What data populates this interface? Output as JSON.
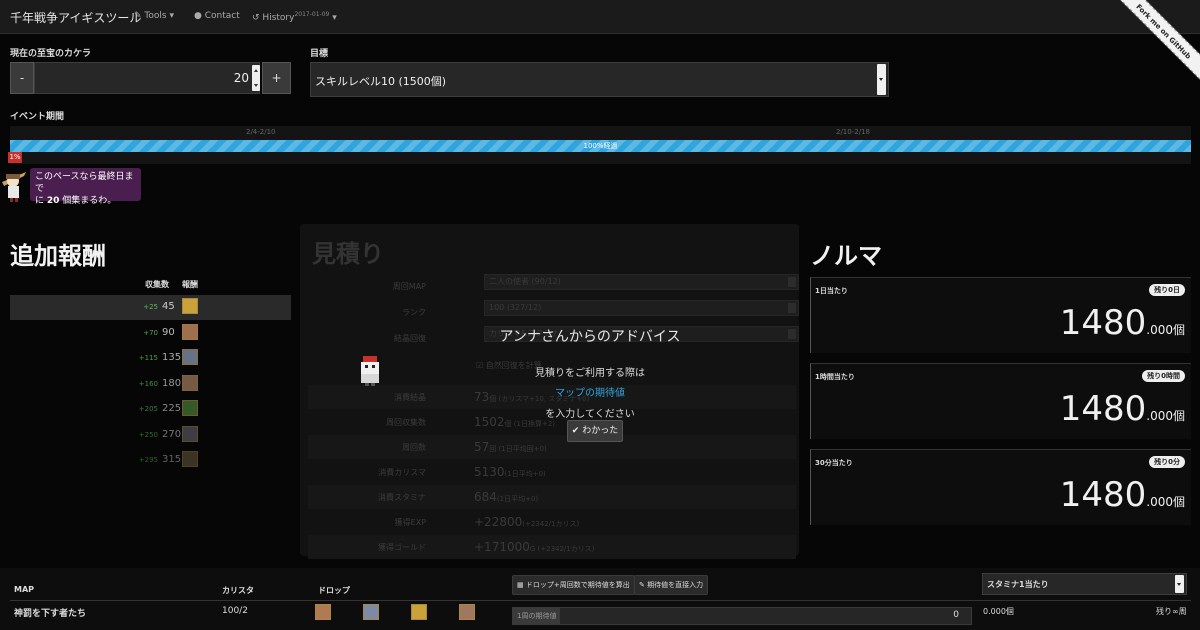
{
  "nav": {
    "brand": "千年戦争アイギスツール",
    "tools": "Tools",
    "contact": "Contact",
    "history": "History",
    "history_date": "2017-01-09",
    "fork_ribbon": "Fork me on GitHub"
  },
  "form": {
    "kakera_label": "現在の至宝のカケラ",
    "kakera_value": "20",
    "minus": "-",
    "plus": "+",
    "target_label": "目標",
    "target_value": "スキルレベル10 (1500個)"
  },
  "event": {
    "label": "イベント期間",
    "phase1": "2/4-2/10",
    "phase2": "2/10-2/18",
    "progress_text": "100%経過",
    "progress_fraction": 1.0,
    "percent_badge": "1%",
    "bubble_line1": "このペースなら最終日まで",
    "bubble_pre": "に ",
    "bubble_count": "20",
    "bubble_post": " 個集まるわ。"
  },
  "rewards": {
    "title": "追加報酬",
    "col_count": "収集数",
    "col_reward": "報酬",
    "rows": [
      {
        "delta": "+25",
        "count": "45",
        "color": "#c9a23a"
      },
      {
        "delta": "+70",
        "count": "90",
        "color": "#b07a55"
      },
      {
        "delta": "+115",
        "count": "135",
        "color": "#7d8aa6"
      },
      {
        "delta": "+160",
        "count": "180",
        "color": "#a07860"
      },
      {
        "delta": "+205",
        "count": "225",
        "color": "#4f8a3e"
      },
      {
        "delta": "+250",
        "count": "270",
        "color": "#6a6a7a"
      },
      {
        "delta": "+295",
        "count": "315",
        "color": "#7a6a4a"
      }
    ]
  },
  "estimate": {
    "title": "見積り",
    "map_label": "周回MAP",
    "map_value": "二人の使者 (90/12)",
    "rank_label": "ランク",
    "rank_value": "100 (327/12)",
    "recovery_label": "結晶回復",
    "recovery_value": "カリスマ&スタミナ",
    "auto_label": "自然回復を計算",
    "rows": [
      {
        "label": "消費結晶",
        "value": "73",
        "note": "個 (カリスマ+10, スタミナ+0)"
      },
      {
        "label": "周回収集数",
        "value": "1502",
        "note": "個 (1日換算+2)"
      },
      {
        "label": "周回数",
        "value": "57",
        "note": "回 (1日平均回+0)"
      },
      {
        "label": "消費カリスマ",
        "value": "5130",
        "note": "(1日平均+0)"
      },
      {
        "label": "消費スタミナ",
        "value": "684",
        "note": "(1日平均+0)"
      },
      {
        "label": "獲得EXP",
        "value": "+22800",
        "note": "(+2342/1カリス)"
      },
      {
        "label": "獲得ゴールド",
        "value": "+171000",
        "note": "G (+2342/1カリス)"
      }
    ]
  },
  "advice": {
    "title": "アンナさんからのアドバイス",
    "line1": "見積りをご利用する際は",
    "link": "マップの期待値",
    "line2": "を入力してください",
    "button": "わかった"
  },
  "quota": {
    "title": "ノルマ",
    "cards": [
      {
        "label": "1日当たり",
        "badge": "残り0日",
        "value": "1480",
        "decimal": ".000個"
      },
      {
        "label": "1時間当たり",
        "badge": "残り0時間",
        "value": "1480",
        "decimal": ".000個"
      },
      {
        "label": "30分当たり",
        "badge": "残り0分",
        "value": "1480",
        "decimal": ".000個"
      }
    ]
  },
  "table": {
    "col_map": "MAP",
    "col_charisma": "カリスタ",
    "col_drop": "ドロップ",
    "btn_calc": "ドロップ+周回数で期待値を算出",
    "btn_direct": "期待値を直接入力",
    "sort_select": "スタミナ1当たり",
    "rows": [
      {
        "map": "神罰を下す者たち",
        "charisma": "100/2",
        "expect_label": "1周の期待値",
        "expect_value": "0",
        "per": "0.000個",
        "remain": "残り∞周"
      }
    ]
  }
}
